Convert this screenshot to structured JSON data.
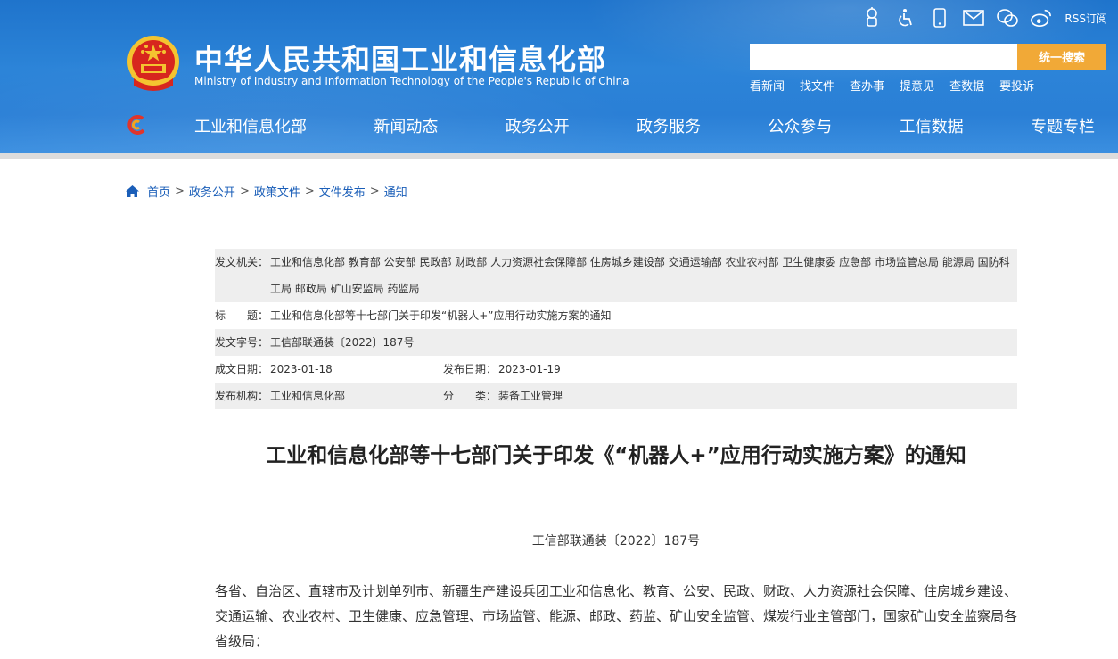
{
  "header": {
    "site_title": "中华人民共和国工业和信息化部",
    "site_subtitle": "Ministry of Industry and Information Technology of the People's Republic of China",
    "rss_label": "RSS订阅",
    "search": {
      "placeholder": "",
      "button_label": "统一搜索"
    },
    "quick_links": [
      "看新闻",
      "找文件",
      "查办事",
      "提意见",
      "查数据",
      "要投诉"
    ],
    "nav": [
      "工业和信息化部",
      "新闻动态",
      "政务公开",
      "政务服务",
      "公众参与",
      "工信数据",
      "专题专栏"
    ],
    "accent_color": "#f1a937",
    "header_color": "#2a7fd6"
  },
  "breadcrumb": [
    "首页",
    "政务公开",
    "政策文件",
    "文件发布",
    "通知"
  ],
  "meta": {
    "issuer_label": "发文机关：",
    "issuer_line1": "工业和信息化部 教育部 公安部 民政部 财政部 人力资源社会保障部 住房城乡建设部 交通运输部 农业农村部 卫生健康委 应急部 市场监管总局 能源局 国防科",
    "issuer_line2": "工局 邮政局 矿山安监局 药监局",
    "title_label": "标　　题：",
    "title_value": "工业和信息化部等十七部门关于印发“机器人+”应用行动实施方案的通知",
    "docno_label": "发文字号：",
    "docno_value": "工信部联通装〔2022〕187号",
    "written_label": "成文日期：",
    "written_value": "2023-01-18",
    "published_label": "发布日期：",
    "published_value": "2023-01-19",
    "org_label": "发布机构：",
    "org_value": "工业和信息化部",
    "category_label": "分　　类：",
    "category_value": "装备工业管理"
  },
  "document": {
    "title": "工业和信息化部等十七部门关于印发《“机器人+”应用行动实施方案》的通知",
    "number": "工信部联通装〔2022〕187号",
    "salutation": "各省、自治区、直辖市及计划单列市、新疆生产建设兵团工业和信息化、教育、公安、民政、财政、人力资源社会保障、住房城乡建设、交通运输、农业农村、卫生健康、应急管理、市场监管、能源、邮政、药监、矿山安全监管、煤炭行业主管部门，国家矿山安全监察局各省级局："
  }
}
